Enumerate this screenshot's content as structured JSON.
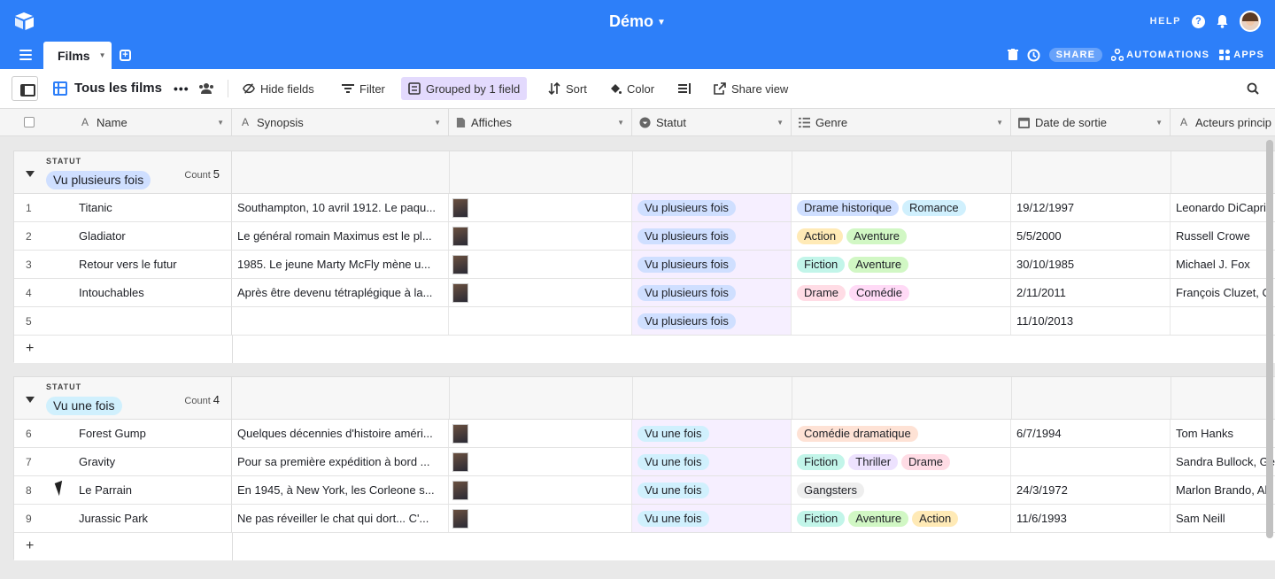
{
  "app": {
    "base_name": "Démo",
    "help_label": "HELP",
    "colors": {
      "header": "#2d7ff9",
      "active_tool": "#e3dafd"
    }
  },
  "tabs": [
    {
      "label": "Films"
    }
  ],
  "top_actions": {
    "share_label": "SHARE",
    "automations_label": "AUTOMATIONS",
    "apps_label": "APPS"
  },
  "toolbar": {
    "view_name": "Tous les films",
    "hide_fields": "Hide fields",
    "filter": "Filter",
    "grouped": "Grouped by 1 field",
    "sort": "Sort",
    "color": "Color",
    "share_view": "Share view"
  },
  "columns": [
    "Name",
    "Synopsis",
    "Affiches",
    "Statut",
    "Genre",
    "Date de sortie",
    "Acteurs princip"
  ],
  "groups": [
    {
      "label": "STATUT",
      "value": "Vu plusieurs fois",
      "count_label": "Count",
      "count": "5",
      "rows": [
        {
          "num": "1",
          "name": "Titanic",
          "synopsis": "Southampton, 10 avril 1912. Le paqu...",
          "statut": "Vu plusieurs fois",
          "genres": [
            "Drame historique",
            "Romance"
          ],
          "date": "19/12/1997",
          "acteurs": "Leonardo DiCaprio"
        },
        {
          "num": "2",
          "name": "Gladiator",
          "synopsis": "Le général romain Maximus est le pl...",
          "statut": "Vu plusieurs fois",
          "genres": [
            "Action",
            "Aventure"
          ],
          "date": "5/5/2000",
          "acteurs": "Russell Crowe"
        },
        {
          "num": "3",
          "name": "Retour vers le futur",
          "synopsis": "1985. Le jeune Marty McFly mène u...",
          "statut": "Vu plusieurs fois",
          "genres": [
            "Fiction",
            "Aventure"
          ],
          "date": "30/10/1985",
          "acteurs": "Michael J. Fox"
        },
        {
          "num": "4",
          "name": "Intouchables",
          "synopsis": "Après être devenu tétraplégique à la...",
          "statut": "Vu plusieurs fois",
          "genres": [
            "Drame",
            "Comédie"
          ],
          "date": "2/11/2011",
          "acteurs": "François Cluzet, O"
        },
        {
          "num": "5",
          "name": "",
          "synopsis": "",
          "statut": "Vu plusieurs fois",
          "genres": [],
          "date": "11/10/2013",
          "acteurs": ""
        }
      ]
    },
    {
      "label": "STATUT",
      "value": "Vu une fois",
      "count_label": "Count",
      "count": "4",
      "rows": [
        {
          "num": "6",
          "name": "Forest Gump",
          "synopsis": "Quelques décennies d'histoire améri...",
          "statut": "Vu une fois",
          "genres": [
            "Comédie dramatique"
          ],
          "date": "6/7/1994",
          "acteurs": "Tom Hanks"
        },
        {
          "num": "7",
          "name": "Gravity",
          "synopsis": "Pour sa première expédition à bord ...",
          "statut": "Vu une fois",
          "genres": [
            "Fiction",
            "Thriller",
            "Drame"
          ],
          "date": "",
          "acteurs": "Sandra Bullock, Ge"
        },
        {
          "num": "8",
          "name": "Le Parrain",
          "synopsis": "En 1945, à New York, les Corleone s...",
          "statut": "Vu une fois",
          "genres": [
            "Gangsters"
          ],
          "date": "24/3/1972",
          "acteurs": "Marlon Brando, Al"
        },
        {
          "num": "9",
          "name": "Jurassic Park",
          "synopsis": "Ne pas réveiller le chat qui dort... C'...",
          "statut": "Vu une fois",
          "genres": [
            "Fiction",
            "Aventure",
            "Action"
          ],
          "date": "11/6/1993",
          "acteurs": "Sam Neill"
        }
      ]
    }
  ],
  "add_row_label": "+",
  "pill_colors": {
    "Vu plusieurs fois": "#cfdfff",
    "Vu une fois": "#d0f0fd",
    "Drame historique": "#cfdfff",
    "Romance": "#d0f0fd",
    "Action": "#ffeab6",
    "Aventure": "#d1f7c4",
    "Fiction": "#c2f5e9",
    "Drame": "#ffdce5",
    "Comédie": "#ffdaf6",
    "Comédie dramatique": "#fee2d5",
    "Thriller": "#ede2fe",
    "Gangsters": "#eeeeee"
  }
}
